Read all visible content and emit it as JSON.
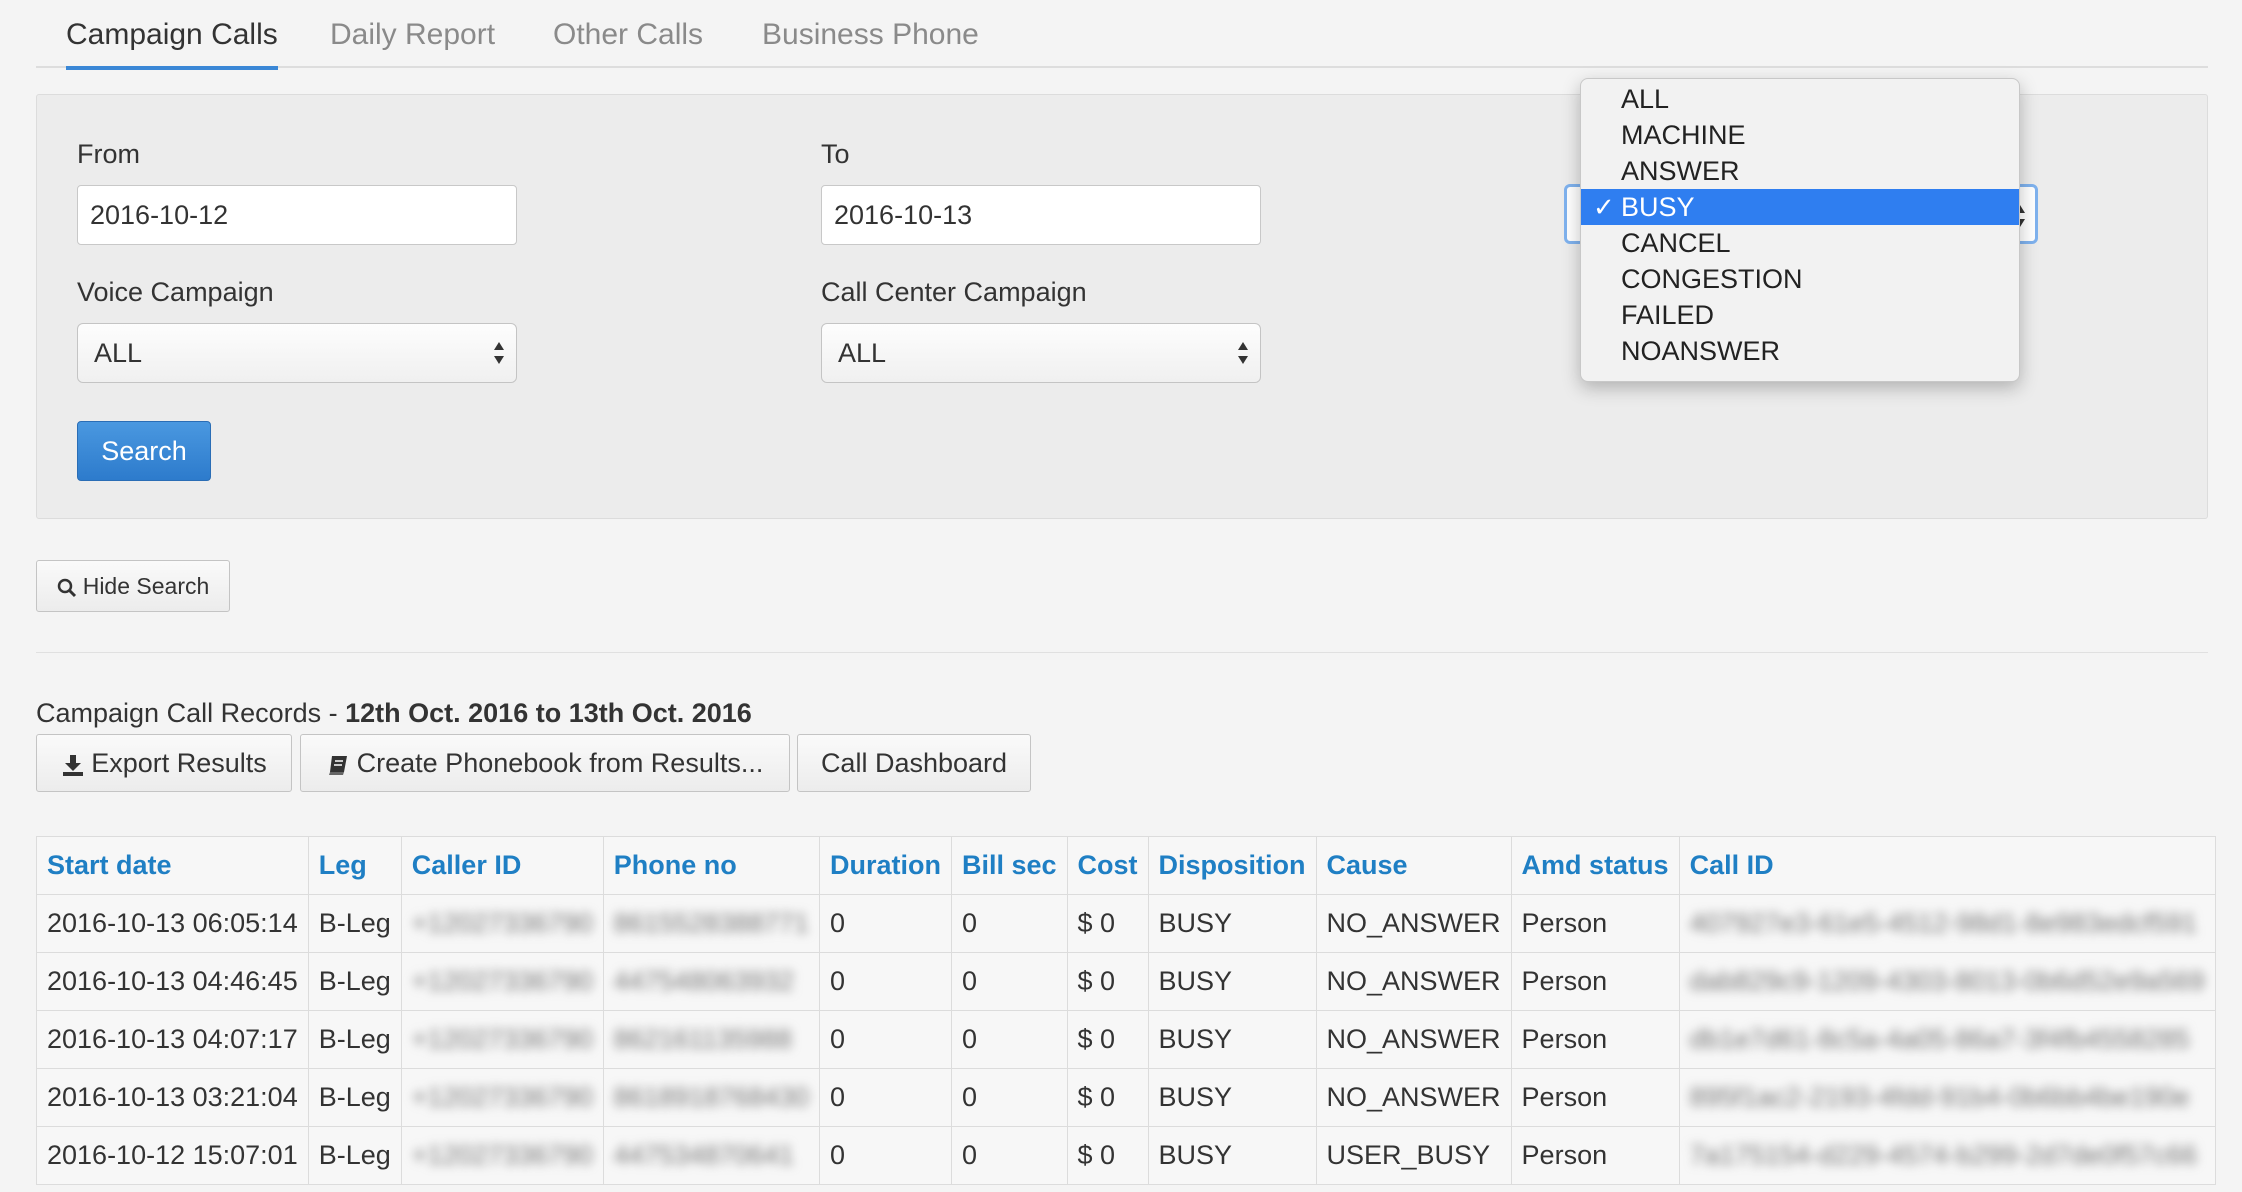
{
  "tabs": [
    {
      "label": "Campaign Calls",
      "active": true
    },
    {
      "label": "Daily Report",
      "active": false
    },
    {
      "label": "Other Calls",
      "active": false
    },
    {
      "label": "Business Phone",
      "active": false
    }
  ],
  "search": {
    "from_label": "From",
    "from_value": "2016-10-12",
    "to_label": "To",
    "to_value": "2016-10-13",
    "voice_campaign_label": "Voice Campaign",
    "voice_campaign_value": "ALL",
    "call_center_label": "Call Center Campaign",
    "call_center_value": "ALL",
    "search_button": "Search"
  },
  "disposition_dropdown": {
    "options": [
      "ALL",
      "MACHINE",
      "ANSWER",
      "BUSY",
      "CANCEL",
      "CONGESTION",
      "FAILED",
      "NOANSWER"
    ],
    "selected": "BUSY",
    "check_glyph": "✓"
  },
  "hide_search_button": "Hide Search",
  "records": {
    "title_prefix": "Campaign Call Records - ",
    "title_range": "12th Oct. 2016 to 13th Oct. 2016"
  },
  "actions": {
    "export": "Export Results",
    "create_phonebook": "Create Phonebook from Results...",
    "dashboard": "Call Dashboard"
  },
  "table": {
    "columns": [
      "Start date",
      "Leg",
      "Caller ID",
      "Phone no",
      "Duration",
      "Bill sec",
      "Cost",
      "Disposition",
      "Cause",
      "Amd status",
      "Call ID"
    ],
    "rows": [
      [
        "2016-10-13 06:05:14",
        "B-Leg",
        "+12027336790",
        "8615528388771",
        "0",
        "0",
        "$ 0",
        "BUSY",
        "NO_ANSWER",
        "Person",
        "407927e3-61e5-4512-98d1-8e983edcf591"
      ],
      [
        "2016-10-13 04:46:45",
        "B-Leg",
        "+12027336790",
        "447548063932",
        "0",
        "0",
        "$ 0",
        "BUSY",
        "NO_ANSWER",
        "Person",
        "dab829c9-1209-4303-8013-0b6d52e9a569"
      ],
      [
        "2016-10-13 04:07:17",
        "B-Leg",
        "+12027336790",
        "862161135988",
        "0",
        "0",
        "$ 0",
        "BUSY",
        "NO_ANSWER",
        "Person",
        "db1e7d61-8c5a-4a05-86a7-3f4fb4558285"
      ],
      [
        "2016-10-13 03:21:04",
        "B-Leg",
        "+12027336790",
        "8618918768430",
        "0",
        "0",
        "$ 0",
        "BUSY",
        "NO_ANSWER",
        "Person",
        "895f1ac2-2193-4fdd-91b4-0b6bb4be190e"
      ],
      [
        "2016-10-12 15:07:01",
        "B-Leg",
        "+12027336790",
        "447534870641",
        "0",
        "0",
        "$ 0",
        "BUSY",
        "USER_BUSY",
        "Person",
        "7a175154-d229-4574-b299-2d7de0f57c66"
      ]
    ]
  }
}
